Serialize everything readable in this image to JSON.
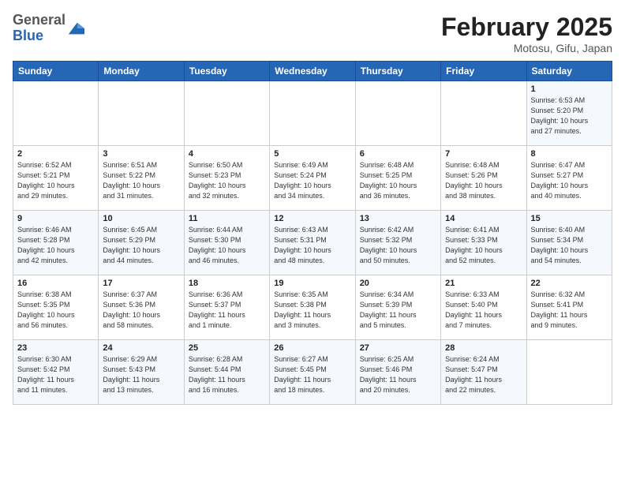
{
  "header": {
    "logo_general": "General",
    "logo_blue": "Blue",
    "month": "February 2025",
    "location": "Motosu, Gifu, Japan"
  },
  "weekdays": [
    "Sunday",
    "Monday",
    "Tuesday",
    "Wednesday",
    "Thursday",
    "Friday",
    "Saturday"
  ],
  "weeks": [
    [
      {
        "day": "",
        "info": ""
      },
      {
        "day": "",
        "info": ""
      },
      {
        "day": "",
        "info": ""
      },
      {
        "day": "",
        "info": ""
      },
      {
        "day": "",
        "info": ""
      },
      {
        "day": "",
        "info": ""
      },
      {
        "day": "1",
        "info": "Sunrise: 6:53 AM\nSunset: 5:20 PM\nDaylight: 10 hours\nand 27 minutes."
      }
    ],
    [
      {
        "day": "2",
        "info": "Sunrise: 6:52 AM\nSunset: 5:21 PM\nDaylight: 10 hours\nand 29 minutes."
      },
      {
        "day": "3",
        "info": "Sunrise: 6:51 AM\nSunset: 5:22 PM\nDaylight: 10 hours\nand 31 minutes."
      },
      {
        "day": "4",
        "info": "Sunrise: 6:50 AM\nSunset: 5:23 PM\nDaylight: 10 hours\nand 32 minutes."
      },
      {
        "day": "5",
        "info": "Sunrise: 6:49 AM\nSunset: 5:24 PM\nDaylight: 10 hours\nand 34 minutes."
      },
      {
        "day": "6",
        "info": "Sunrise: 6:48 AM\nSunset: 5:25 PM\nDaylight: 10 hours\nand 36 minutes."
      },
      {
        "day": "7",
        "info": "Sunrise: 6:48 AM\nSunset: 5:26 PM\nDaylight: 10 hours\nand 38 minutes."
      },
      {
        "day": "8",
        "info": "Sunrise: 6:47 AM\nSunset: 5:27 PM\nDaylight: 10 hours\nand 40 minutes."
      }
    ],
    [
      {
        "day": "9",
        "info": "Sunrise: 6:46 AM\nSunset: 5:28 PM\nDaylight: 10 hours\nand 42 minutes."
      },
      {
        "day": "10",
        "info": "Sunrise: 6:45 AM\nSunset: 5:29 PM\nDaylight: 10 hours\nand 44 minutes."
      },
      {
        "day": "11",
        "info": "Sunrise: 6:44 AM\nSunset: 5:30 PM\nDaylight: 10 hours\nand 46 minutes."
      },
      {
        "day": "12",
        "info": "Sunrise: 6:43 AM\nSunset: 5:31 PM\nDaylight: 10 hours\nand 48 minutes."
      },
      {
        "day": "13",
        "info": "Sunrise: 6:42 AM\nSunset: 5:32 PM\nDaylight: 10 hours\nand 50 minutes."
      },
      {
        "day": "14",
        "info": "Sunrise: 6:41 AM\nSunset: 5:33 PM\nDaylight: 10 hours\nand 52 minutes."
      },
      {
        "day": "15",
        "info": "Sunrise: 6:40 AM\nSunset: 5:34 PM\nDaylight: 10 hours\nand 54 minutes."
      }
    ],
    [
      {
        "day": "16",
        "info": "Sunrise: 6:38 AM\nSunset: 5:35 PM\nDaylight: 10 hours\nand 56 minutes."
      },
      {
        "day": "17",
        "info": "Sunrise: 6:37 AM\nSunset: 5:36 PM\nDaylight: 10 hours\nand 58 minutes."
      },
      {
        "day": "18",
        "info": "Sunrise: 6:36 AM\nSunset: 5:37 PM\nDaylight: 11 hours\nand 1 minute."
      },
      {
        "day": "19",
        "info": "Sunrise: 6:35 AM\nSunset: 5:38 PM\nDaylight: 11 hours\nand 3 minutes."
      },
      {
        "day": "20",
        "info": "Sunrise: 6:34 AM\nSunset: 5:39 PM\nDaylight: 11 hours\nand 5 minutes."
      },
      {
        "day": "21",
        "info": "Sunrise: 6:33 AM\nSunset: 5:40 PM\nDaylight: 11 hours\nand 7 minutes."
      },
      {
        "day": "22",
        "info": "Sunrise: 6:32 AM\nSunset: 5:41 PM\nDaylight: 11 hours\nand 9 minutes."
      }
    ],
    [
      {
        "day": "23",
        "info": "Sunrise: 6:30 AM\nSunset: 5:42 PM\nDaylight: 11 hours\nand 11 minutes."
      },
      {
        "day": "24",
        "info": "Sunrise: 6:29 AM\nSunset: 5:43 PM\nDaylight: 11 hours\nand 13 minutes."
      },
      {
        "day": "25",
        "info": "Sunrise: 6:28 AM\nSunset: 5:44 PM\nDaylight: 11 hours\nand 16 minutes."
      },
      {
        "day": "26",
        "info": "Sunrise: 6:27 AM\nSunset: 5:45 PM\nDaylight: 11 hours\nand 18 minutes."
      },
      {
        "day": "27",
        "info": "Sunrise: 6:25 AM\nSunset: 5:46 PM\nDaylight: 11 hours\nand 20 minutes."
      },
      {
        "day": "28",
        "info": "Sunrise: 6:24 AM\nSunset: 5:47 PM\nDaylight: 11 hours\nand 22 minutes."
      },
      {
        "day": "",
        "info": ""
      }
    ]
  ]
}
